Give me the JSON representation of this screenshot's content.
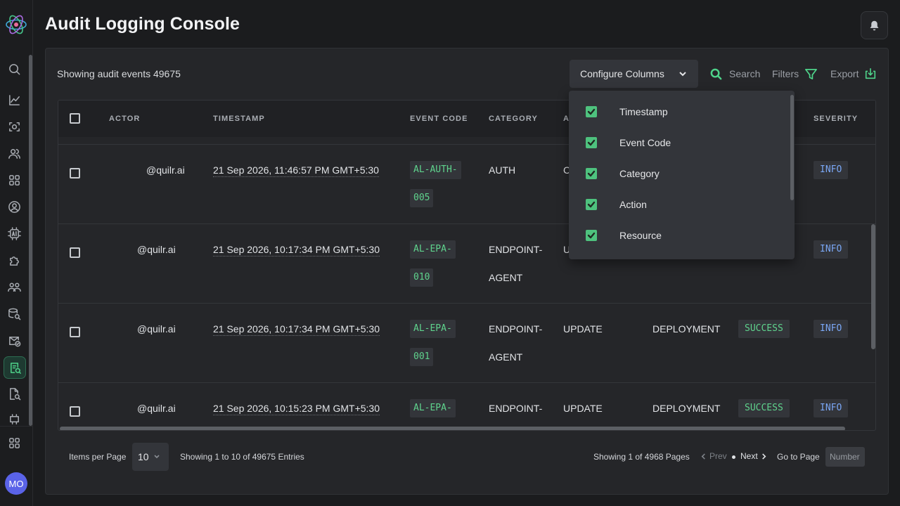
{
  "header": {
    "title": "Audit Logging Console"
  },
  "user": {
    "initials": "MO"
  },
  "sidebar": {
    "items": [
      {
        "icon": "search-icon"
      },
      {
        "icon": "analytics-icon"
      },
      {
        "icon": "scan-icon"
      },
      {
        "icon": "users-icon"
      },
      {
        "icon": "apps-icon"
      },
      {
        "icon": "user-circle-icon"
      },
      {
        "icon": "ai-chip-icon"
      },
      {
        "icon": "puzzle-icon"
      },
      {
        "icon": "team-icon"
      },
      {
        "icon": "database-search-icon"
      },
      {
        "icon": "mail-check-icon"
      },
      {
        "icon": "audit-log-icon",
        "active": true
      },
      {
        "icon": "document-search-icon"
      },
      {
        "icon": "integration-icon"
      },
      {
        "icon": "grid-icon"
      }
    ]
  },
  "toolbar": {
    "count_text": "Showing audit events 49675",
    "configure_label": "Configure Columns",
    "search_label": "Search",
    "filters_label": "Filters",
    "export_label": "Export"
  },
  "table": {
    "columns": [
      "ACTOR",
      "TIMESTAMP",
      "EVENT CODE",
      "CATEGORY",
      "A",
      "SEVERITY"
    ],
    "rows": [
      {
        "actor": "@quilr.ai",
        "timestamp": "21 Sep 2026, 11:46:57 PM GMT+5:30",
        "code1": "AL-AUTH-",
        "code2": "005",
        "category1": "AUTH",
        "category2": "",
        "action": "C",
        "resource": "",
        "status": "",
        "severity": "INFO"
      },
      {
        "actor": "@quilr.ai",
        "timestamp": "21 Sep 2026, 10:17:34 PM GMT+5:30",
        "code1": "AL-EPA-",
        "code2": "010",
        "category1": "ENDPOINT-",
        "category2": "AGENT",
        "action": "U",
        "resource": "",
        "status": "",
        "severity": "INFO"
      },
      {
        "actor": "@quilr.ai",
        "timestamp": "21 Sep 2026, 10:17:34 PM GMT+5:30",
        "code1": "AL-EPA-",
        "code2": "001",
        "category1": "ENDPOINT-",
        "category2": "AGENT",
        "action": "UPDATE",
        "resource": "DEPLOYMENT",
        "status": "SUCCESS",
        "severity": "INFO"
      },
      {
        "actor": "@quilr.ai",
        "timestamp": "21 Sep 2026, 10:15:23 PM GMT+5:30",
        "code1": "AL-EPA-",
        "code2": "",
        "category1": "ENDPOINT-",
        "category2": "",
        "action": "UPDATE",
        "resource": "DEPLOYMENT",
        "status": "SUCCESS",
        "severity": "INFO"
      }
    ]
  },
  "column_menu": {
    "items": [
      {
        "label": "Timestamp",
        "checked": true
      },
      {
        "label": "Event Code",
        "checked": true
      },
      {
        "label": "Category",
        "checked": true
      },
      {
        "label": "Action",
        "checked": true
      },
      {
        "label": "Resource",
        "checked": true
      }
    ]
  },
  "footer": {
    "items_per_page_label": "Items per Page",
    "items_per_page_value": "10",
    "entries_text": "Showing 1 to 10 of 49675 Entries",
    "pages_text": "Showing 1 of 4968 Pages",
    "prev_label": "Prev",
    "next_label": "Next",
    "goto_label": "Go to Page",
    "goto_placeholder": "Number"
  },
  "colors": {
    "accent_green": "#4ed38a",
    "info_blue": "#7aa7f5",
    "background": "#1b1c1e",
    "panel": "#252629"
  }
}
